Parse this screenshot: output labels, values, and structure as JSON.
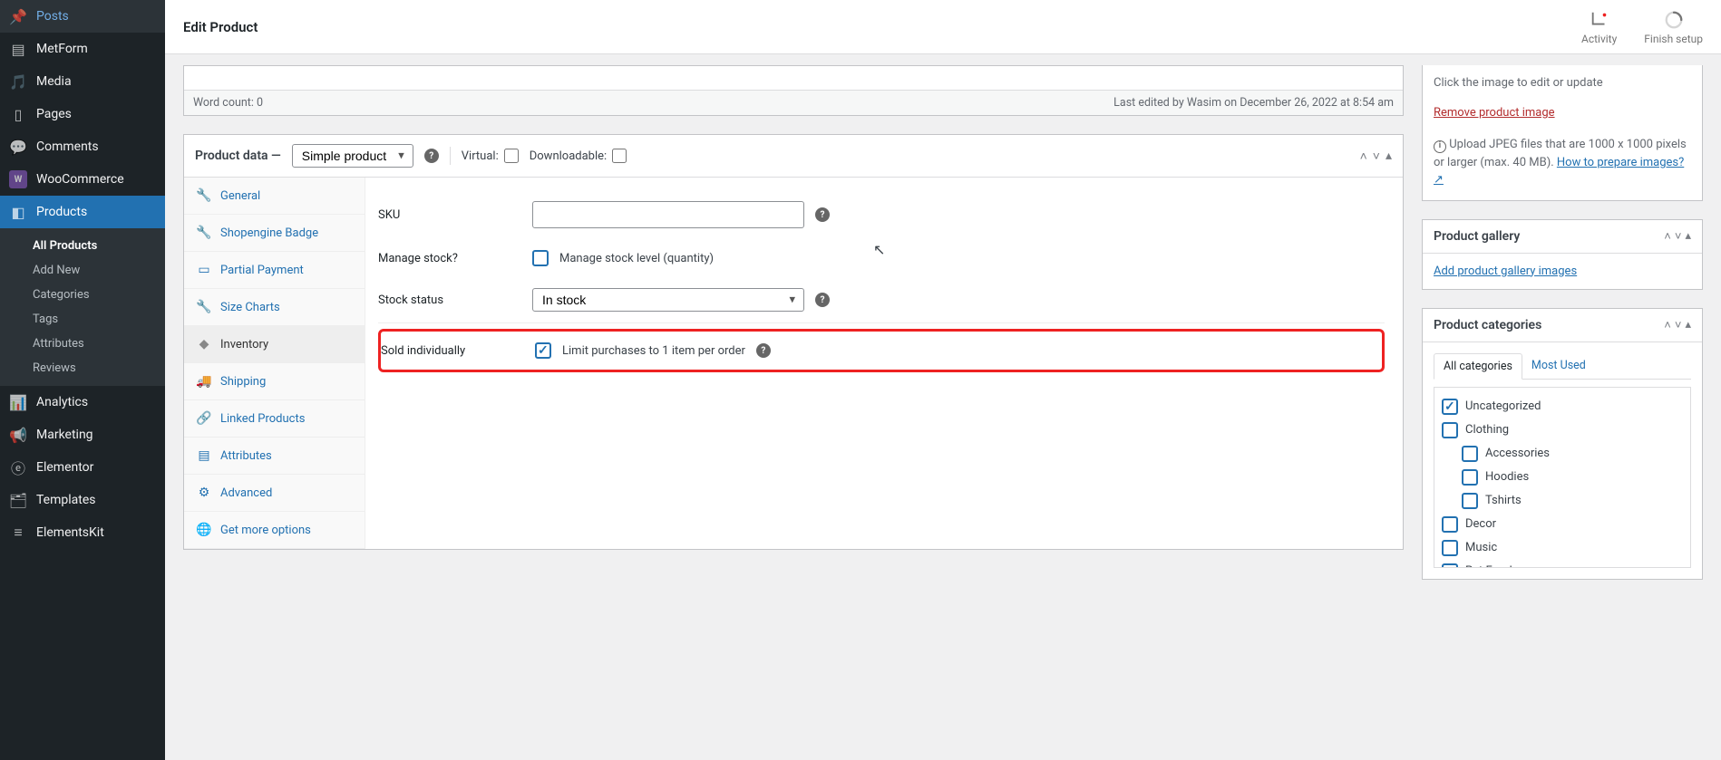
{
  "topbar": {
    "title": "Edit Product",
    "activity_label": "Activity",
    "finish_label": "Finish setup"
  },
  "sidebar": {
    "items": [
      {
        "label": "Posts",
        "icon": "📌"
      },
      {
        "label": "MetForm",
        "icon": "▤"
      },
      {
        "label": "Media",
        "icon": "🖼"
      },
      {
        "label": "Pages",
        "icon": "▯"
      },
      {
        "label": "Comments",
        "icon": "💬"
      },
      {
        "label": "WooCommerce",
        "icon": "W"
      },
      {
        "label": "Products",
        "icon": "◧"
      },
      {
        "label": "Analytics",
        "icon": "📊"
      },
      {
        "label": "Marketing",
        "icon": "📢"
      },
      {
        "label": "Elementor",
        "icon": "ⓔ"
      },
      {
        "label": "Templates",
        "icon": "🗂"
      },
      {
        "label": "ElementsKit",
        "icon": "≡"
      }
    ],
    "submenu": [
      "All Products",
      "Add New",
      "Categories",
      "Tags",
      "Attributes",
      "Reviews"
    ]
  },
  "editor_footer": {
    "word_count": "Word count: 0",
    "last_edit": "Last edited by Wasim on December 26, 2022 at 8:54 am"
  },
  "product_data": {
    "title": "Product data —",
    "type": "Simple product",
    "virtual_label": "Virtual:",
    "downloadable_label": "Downloadable:",
    "tabs": [
      {
        "label": "General",
        "icon": "🔧"
      },
      {
        "label": "Shopengine Badge",
        "icon": "🔧"
      },
      {
        "label": "Partial Payment",
        "icon": "▭"
      },
      {
        "label": "Size Charts",
        "icon": "🔧"
      },
      {
        "label": "Inventory",
        "icon": "◆"
      },
      {
        "label": "Shipping",
        "icon": "🚚"
      },
      {
        "label": "Linked Products",
        "icon": "🔗"
      },
      {
        "label": "Attributes",
        "icon": "▤"
      },
      {
        "label": "Advanced",
        "icon": "⚙"
      },
      {
        "label": "Get more options",
        "icon": "🌐"
      }
    ],
    "fields": {
      "sku_label": "SKU",
      "manage_stock_label": "Manage stock?",
      "manage_stock_help": "Manage stock level (quantity)",
      "stock_status_label": "Stock status",
      "stock_status_value": "In stock",
      "sold_individually_label": "Sold individually",
      "sold_individually_help": "Limit purchases to 1 item per order"
    }
  },
  "image_box": {
    "edit_hint": "Click the image to edit or update",
    "remove": "Remove product image",
    "upload_hint": "Upload JPEG files that are 1000 x 1000 pixels or larger (max. 40 MB). ",
    "prepare_link": "How to prepare images?"
  },
  "gallery": {
    "title": "Product gallery",
    "add_link": "Add product gallery images"
  },
  "categories": {
    "title": "Product categories",
    "tab_all": "All categories",
    "tab_most": "Most Used",
    "items": [
      {
        "label": "Uncategorized",
        "checked": true,
        "indent": false
      },
      {
        "label": "Clothing",
        "checked": false,
        "indent": false
      },
      {
        "label": "Accessories",
        "checked": false,
        "indent": true
      },
      {
        "label": "Hoodies",
        "checked": false,
        "indent": true
      },
      {
        "label": "Tshirts",
        "checked": false,
        "indent": true
      },
      {
        "label": "Decor",
        "checked": false,
        "indent": false
      },
      {
        "label": "Music",
        "checked": false,
        "indent": false
      },
      {
        "label": "Pet Food",
        "checked": false,
        "indent": false
      }
    ]
  }
}
